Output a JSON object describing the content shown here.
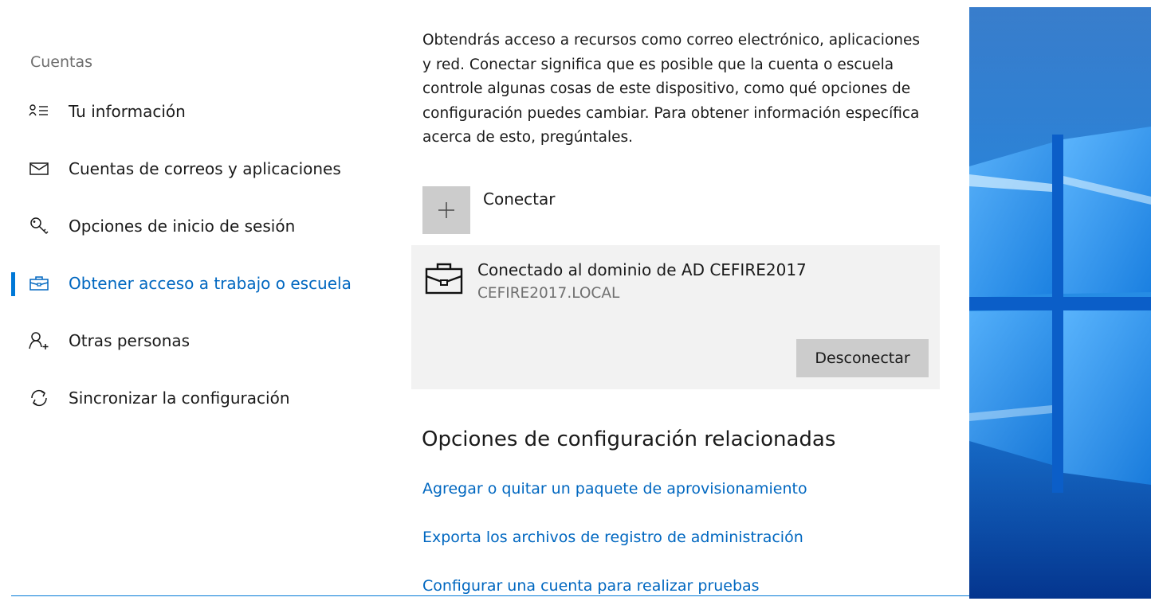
{
  "sidebar": {
    "section_label": "Cuentas",
    "items": [
      {
        "label": "Tu información",
        "icon": "contact-info-icon",
        "active": false
      },
      {
        "label": "Cuentas de correos y aplicaciones",
        "icon": "mail-icon",
        "active": false
      },
      {
        "label": "Opciones de inicio de sesión",
        "icon": "key-icon",
        "active": false
      },
      {
        "label": "Obtener acceso a trabajo o escuela",
        "icon": "briefcase-icon",
        "active": true
      },
      {
        "label": "Otras personas",
        "icon": "add-person-icon",
        "active": false
      },
      {
        "label": "Sincronizar la configuración",
        "icon": "sync-icon",
        "active": false
      }
    ]
  },
  "main": {
    "description": "Obtendrás acceso a recursos como correo electrónico, aplicaciones y red. Conectar significa que es posible que la cuenta o escuela controle algunas cosas de este dispositivo, como qué opciones de configuración puedes cambiar. Para obtener información específica acerca de esto, pregúntales.",
    "connect_label": "Conectar",
    "account": {
      "title": "Conectado al dominio de AD CEFIRE2017",
      "domain": "CEFIRE2017.LOCAL",
      "disconnect_label": "Desconectar"
    },
    "related": {
      "heading": "Opciones de configuración relacionadas",
      "links": [
        "Agregar o quitar un paquete de aprovisionamiento",
        "Exporta los archivos de registro de administración",
        "Configurar una cuenta para realizar pruebas"
      ]
    }
  },
  "colors": {
    "accent": "#0078d7",
    "link": "#0067c0",
    "tile": "#cccccc",
    "card": "#f2f2f2"
  }
}
